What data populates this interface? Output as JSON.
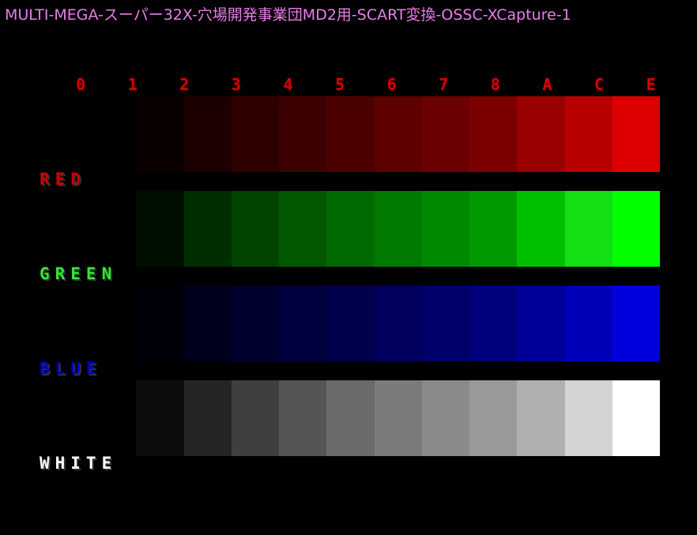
{
  "caption": "MULTI-MEGA-スーパー32X-穴場開発事業団MD2用-SCART変換-OSSC-XCapture-1",
  "hex_levels": [
    "0",
    "1",
    "2",
    "3",
    "4",
    "5",
    "6",
    "7",
    "8",
    "A",
    "C",
    "E"
  ],
  "bands": [
    {
      "label": "RED",
      "label_color": "#c80000",
      "swatches": [
        "#000000",
        "#0a0000",
        "#1d0000",
        "#2e0000",
        "#3d0000",
        "#4d0000",
        "#5c0000",
        "#6b0000",
        "#7b0000",
        "#990000",
        "#b80000",
        "#dd0000"
      ]
    },
    {
      "label": "GREEN",
      "label_color": "#2ee82e",
      "swatches": [
        "#000000",
        "#000e00",
        "#002e00",
        "#004400",
        "#005800",
        "#006a00",
        "#007a00",
        "#008a00",
        "#009a00",
        "#00c000",
        "#12e012",
        "#00ff00"
      ]
    },
    {
      "label": "BLUE",
      "label_color": "#0000c8",
      "swatches": [
        "#000000",
        "#00000a",
        "#00001c",
        "#00002e",
        "#00003e",
        "#00004c",
        "#00005c",
        "#00006a",
        "#00007c",
        "#000098",
        "#0000b8",
        "#0000dd"
      ]
    },
    {
      "label": "WHITE",
      "label_color": "#ffffff",
      "swatches": [
        "#000000",
        "#0c0c0c",
        "#252525",
        "#3f3f3f",
        "#555555",
        "#6a6a6a",
        "#7b7b7b",
        "#8a8a8a",
        "#999999",
        "#b2afaf",
        "#d6d3d3",
        "#ffffff"
      ]
    }
  ]
}
